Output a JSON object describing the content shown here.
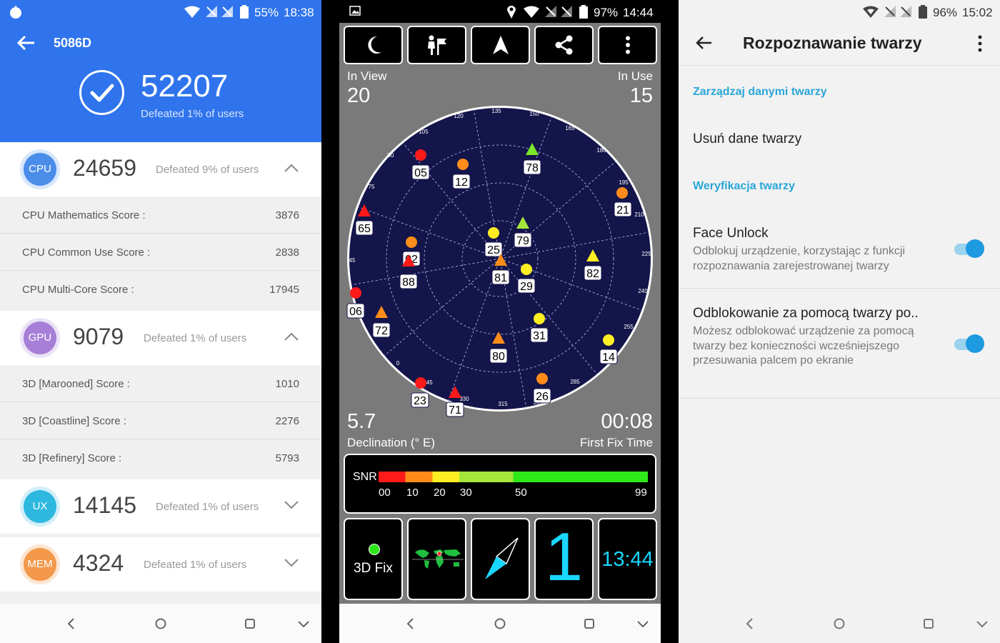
{
  "antutu": {
    "status": {
      "battery": "55%",
      "time": "18:38"
    },
    "title": "5086D",
    "total": "52207",
    "total_defeated": "Defeated 1% of users",
    "cpu": {
      "badge": "CPU",
      "score": "24659",
      "defeated": "Defeated 9% of users",
      "color": "#4a8de8",
      "items": [
        {
          "label": "CPU Mathematics Score :",
          "value": "3876"
        },
        {
          "label": "CPU Common Use Score :",
          "value": "2838"
        },
        {
          "label": "CPU Multi-Core Score :",
          "value": "17945"
        }
      ]
    },
    "gpu": {
      "badge": "GPU",
      "score": "9079",
      "defeated": "Defeated 1% of users",
      "color": "#a77fd6",
      "items": [
        {
          "label": "3D [Marooned] Score :",
          "value": "1010"
        },
        {
          "label": "3D [Coastline] Score :",
          "value": "2276"
        },
        {
          "label": "3D [Refinery] Score :",
          "value": "5793"
        }
      ]
    },
    "ux": {
      "badge": "UX",
      "score": "14145",
      "defeated": "Defeated 1% of users",
      "color": "#2db8e0"
    },
    "mem": {
      "badge": "MEM",
      "score": "4324",
      "defeated": "Defeated 1% of users",
      "color": "#f3984a"
    }
  },
  "gps": {
    "status": {
      "battery": "97%",
      "time": "14:44"
    },
    "in_view_label": "In View",
    "in_view": "20",
    "in_use_label": "In Use",
    "in_use": "15",
    "declination": "5.7",
    "declination_label": "Declination (° E)",
    "fix_time": "00:08",
    "fix_time_label": "First Fix Time",
    "snr_label": "SNR",
    "snr_ticks": [
      "00",
      "10",
      "20",
      "30",
      "50",
      "99"
    ],
    "fix_label": "3D Fix",
    "fix_count": "1",
    "clock": "13:44",
    "ring_labels": [
      "135",
      "150",
      "165",
      "180",
      "195",
      "210",
      "225",
      "240",
      "255",
      "285",
      "300",
      "315",
      "330",
      "345",
      "0",
      "45",
      "75",
      "90",
      "105",
      "120"
    ],
    "satellites": [
      {
        "id": "05",
        "shape": "circle",
        "color": "#ff1a1a"
      },
      {
        "id": "12",
        "shape": "circle",
        "color": "#ff8c1a"
      },
      {
        "id": "78",
        "shape": "triangle",
        "color": "#7be82a"
      },
      {
        "id": "21",
        "shape": "circle",
        "color": "#ff8c1a"
      },
      {
        "id": "65",
        "shape": "triangle",
        "color": "#ff1a1a"
      },
      {
        "id": "79",
        "shape": "triangle",
        "color": "#a6e63a"
      },
      {
        "id": "25",
        "shape": "circle",
        "color": "#ffee22"
      },
      {
        "id": "02",
        "shape": "circle",
        "color": "#ff8c1a"
      },
      {
        "id": "88",
        "shape": "triangle",
        "color": "#ff1a1a"
      },
      {
        "id": "81",
        "shape": "triangle",
        "color": "#ff8c1a"
      },
      {
        "id": "29",
        "shape": "circle",
        "color": "#ffee22"
      },
      {
        "id": "82",
        "shape": "triangle",
        "color": "#ffee22"
      },
      {
        "id": "06",
        "shape": "circle",
        "color": "#ff1a1a"
      },
      {
        "id": "72",
        "shape": "triangle",
        "color": "#ff8c1a"
      },
      {
        "id": "31",
        "shape": "circle",
        "color": "#ffee22"
      },
      {
        "id": "80",
        "shape": "triangle",
        "color": "#ff8c1a"
      },
      {
        "id": "14",
        "shape": "circle",
        "color": "#ffee22"
      },
      {
        "id": "23",
        "shape": "circle",
        "color": "#ff1a1a"
      },
      {
        "id": "71",
        "shape": "triangle",
        "color": "#ff1a1a"
      },
      {
        "id": "26",
        "shape": "circle",
        "color": "#ff8c1a"
      }
    ]
  },
  "settings": {
    "status": {
      "battery": "96%",
      "time": "15:02"
    },
    "title": "Rozpoznawanie twarzy",
    "section1": "Zarządzaj danymi twarzy",
    "remove": "Usuń dane twarzy",
    "section2": "Weryfikacja twarzy",
    "face_unlock": {
      "title": "Face Unlock",
      "desc": "Odblokuj urządzenie, korzystając z funkcji rozpoznawania zarejestrowanej twarzy",
      "on": true
    },
    "swipe_unlock": {
      "title": "Odblokowanie za pomocą twarzy po..",
      "desc": "Możesz odblokować urządzenie za pomocą twarzy bez konieczności wcześniejszego przesuwania palcem po ekranie",
      "on": true
    },
    "accent": "#2aa6d8"
  }
}
